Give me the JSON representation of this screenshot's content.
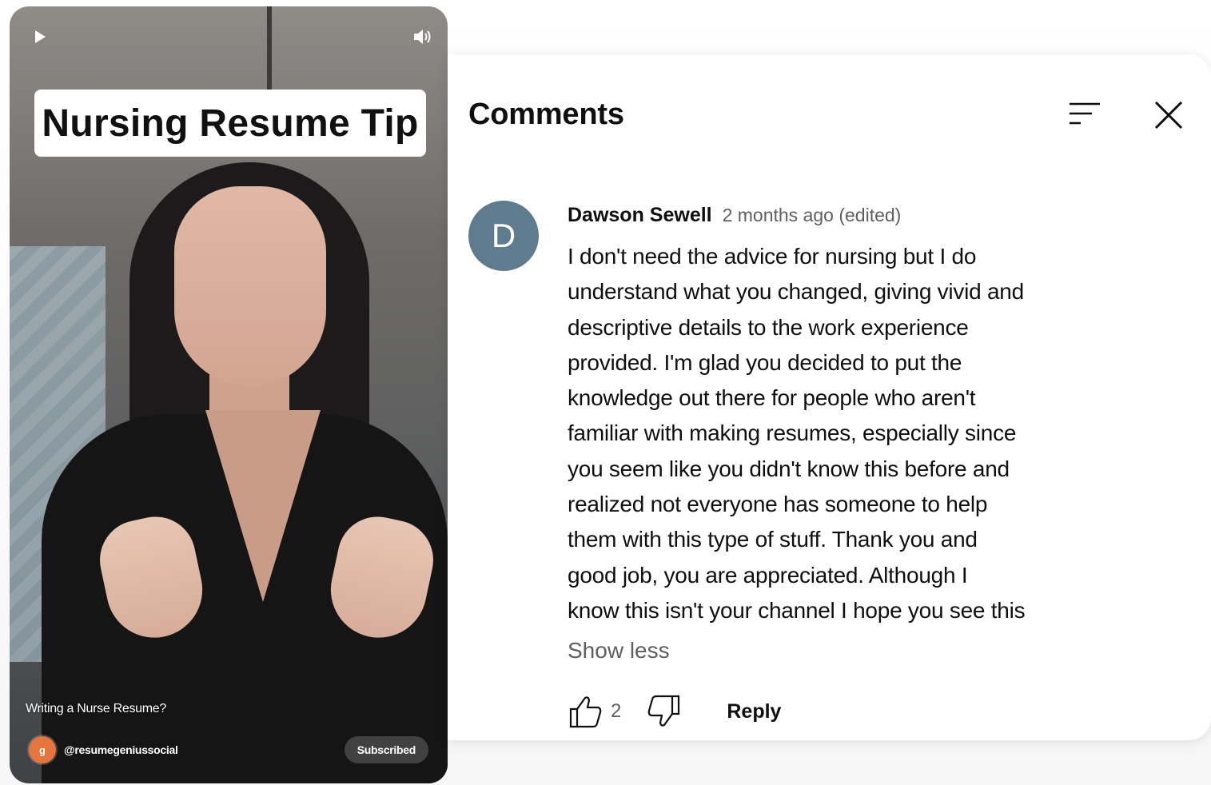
{
  "video": {
    "title_card": "Nursing Resume Tip",
    "caption": "Writing a Nurse Resume?",
    "channel_handle": "@resumegeniussocial",
    "channel_avatar_letter": "g",
    "subscribe_label": "Subscribed",
    "play_icon": "play-icon",
    "volume_icon": "volume-icon"
  },
  "comments_panel": {
    "title": "Comments",
    "sort_icon": "sort-icon",
    "close_icon": "close-icon",
    "items": [
      {
        "avatar_letter": "D",
        "avatar_color": "#5f7b8e",
        "author": "Dawson Sewell",
        "timestamp": "2 months ago (edited)",
        "text": "I don't need the advice for nursing but I do\nunderstand what you changed, giving vivid and\ndescriptive details to the work experience\nprovided. I'm glad you decided to put the\nknowledge out there for people who aren't\nfamiliar with making resumes, especially since\nyou seem like you didn't know this before and\nrealized not everyone has someone to help\nthem with this type of stuff. Thank you and\ngood job, you are appreciated. Although I\nknow this isn't your channel I hope you see this",
        "show_less_label": "Show less",
        "like_count": "2",
        "reply_label": "Reply"
      }
    ]
  }
}
